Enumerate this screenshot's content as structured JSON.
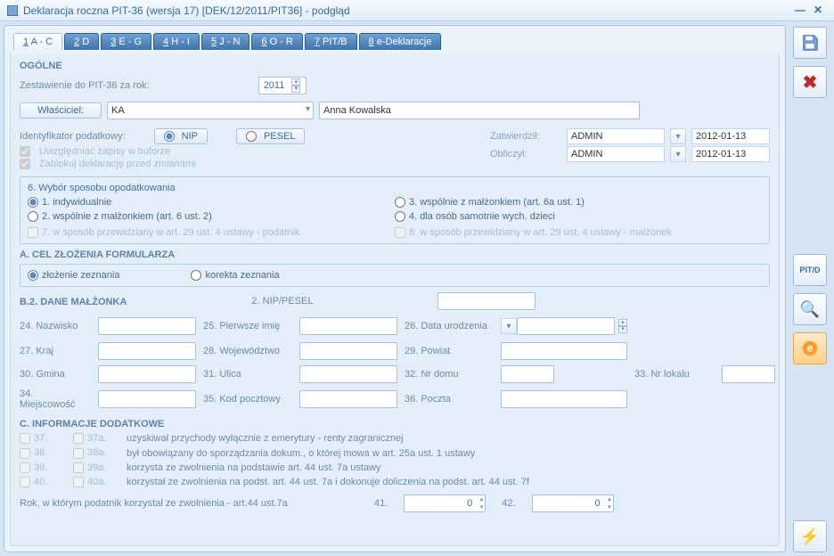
{
  "window_title": "Deklaracja roczna PIT-36 (wersja 17) [DEK/12/2011/PIT36] - podgląd",
  "tabs": [
    "1 A - C",
    "2 D",
    "3 E - G",
    "4 H - I",
    "5 J - N",
    "6 O - R",
    "7 PIT/B",
    "8 e-Deklaracje"
  ],
  "ogolne": {
    "header": "OGÓLNE",
    "year_label": "Zestawienie do PIT-36 za rok:",
    "year": "2011",
    "owner_btn": "Właściciel:",
    "owner_code": "KA",
    "owner_name": "Anna Kowalska",
    "ident_label": "Identyfikator podatkowy:",
    "opt_nip": "NIP",
    "opt_pesel": "PESEL",
    "chk_buffer": "Uwzględniać zapisy w buforze",
    "chk_lock": "Zablokuj deklarację przed zmianami",
    "approve": {
      "zatw_label": "Zatwierdził:",
      "oblicz_label": "Obliczył:",
      "user": "ADMIN",
      "date": "2012-01-13"
    }
  },
  "sec6": {
    "title": "6. Wybór sposobu opodatkowania",
    "opt1": "1. indywidualnie",
    "opt2": "2. wspólnie z małżonkiem (art. 6 ust. 2)",
    "opt3": "3. wspólnie z małżonkiem (art. 6a ust. 1)",
    "opt4": "4. dla osób samotnie wych. dzieci",
    "chk7": "7. w sposób przewidziany w art. 29 ust. 4 ustawy - podatnik",
    "chk8": "8. w sposób przewidziany w art. 29 ust. 4 ustawy - małżonek"
  },
  "secA": {
    "title": "A. CEL ZŁOŻENIA FORMULARZA",
    "opt1": "złożenie zeznania",
    "opt2": "korekta zeznania"
  },
  "secB2": {
    "title": "B.2. DANE MAŁŻONKA",
    "f2": "2. NIP/PESEL",
    "f24": "24. Nazwisko",
    "f25": "25. Pierwsze imię",
    "f26": "26. Data urodzenia",
    "f27": "27. Kraj",
    "f28": "28. Województwo",
    "f29": "29. Powiat",
    "f30": "30. Gmina",
    "f31": "31. Ulica",
    "f32": "32. Nr domu",
    "f33": "33. Nr lokalu",
    "f34": "34. Miejscowość",
    "f35": "35. Kod pocztowy",
    "f36": "36. Poczta"
  },
  "secC": {
    "title": "C. INFORMACJE DODATKOWE",
    "r37": "37.",
    "r37a": "37a.",
    "t37": "uzyskiwał przychody wyłącznie z emerytury - renty zagranicznej",
    "r38": "38.",
    "r38a": "38a.",
    "t38": "był obowiązany do sporządzania dokum., o której mowa w art. 25a ust. 1 ustawy",
    "r39": "39.",
    "r39a": "39a.",
    "t39": "korzysta ze zwolnienia na podstawie art. 44 ust. 7a ustawy",
    "r40": "40.",
    "r40a": "40a.",
    "t40": "korzystał ze zwolnienia na podst. art. 44 ust. 7a i dokonuje doliczenia na podst. art. 44 ust. 7f",
    "footer": "Rok, w którym podatnik korzystał ze zwolnienia - art.44 ust.7a",
    "f41_label": "41.",
    "f42_label": "42.",
    "f41": "0",
    "f42": "0"
  },
  "side": {
    "pitd": "PIT/D"
  }
}
